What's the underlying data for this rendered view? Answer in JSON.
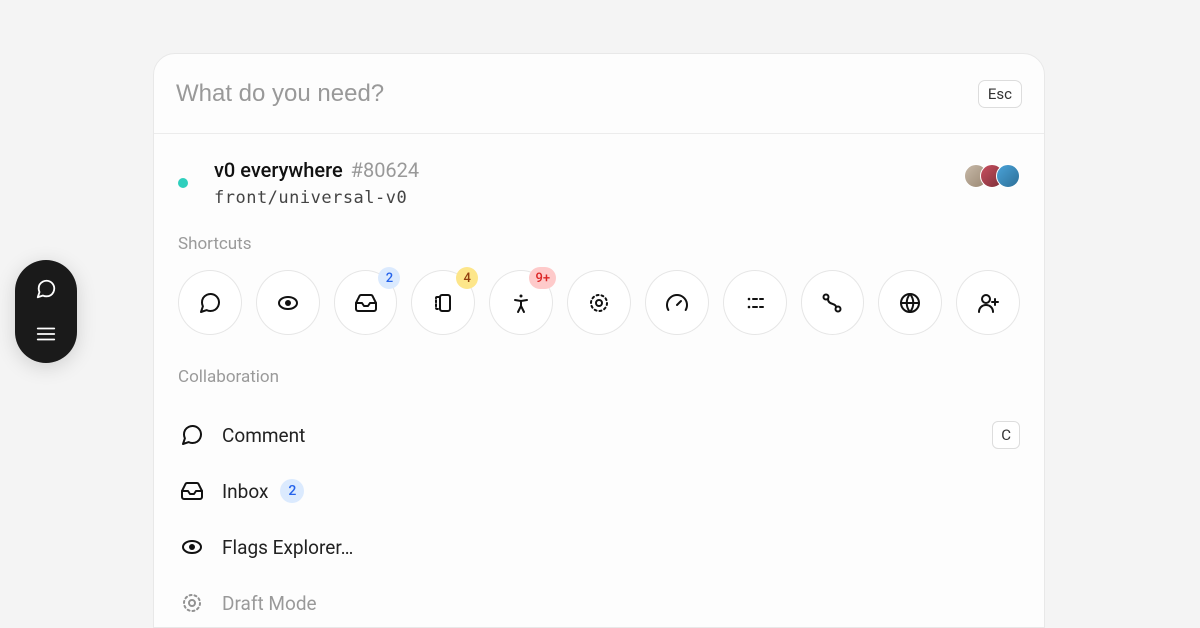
{
  "search": {
    "placeholder": "What do you need?",
    "esc_label": "Esc"
  },
  "top_result": {
    "title": "v0 everywhere",
    "id": "#80624",
    "branch": "front/universal-v0",
    "status": "open"
  },
  "sections": {
    "shortcuts_label": "Shortcuts",
    "collaboration_label": "Collaboration"
  },
  "shortcuts": [
    {
      "icon": "comment",
      "badge": null
    },
    {
      "icon": "eye",
      "badge": null
    },
    {
      "icon": "inbox",
      "badge": {
        "text": "2",
        "color": "blue"
      }
    },
    {
      "icon": "layout",
      "badge": {
        "text": "4",
        "color": "amber"
      }
    },
    {
      "icon": "accessibility",
      "badge": {
        "text": "9+",
        "color": "red"
      }
    },
    {
      "icon": "draft",
      "badge": null
    },
    {
      "icon": "gauge",
      "badge": null
    },
    {
      "icon": "grid",
      "badge": null
    },
    {
      "icon": "branch",
      "badge": null
    },
    {
      "icon": "globe",
      "badge": null
    },
    {
      "icon": "add-user",
      "badge": null
    }
  ],
  "collaboration": [
    {
      "icon": "comment",
      "label": "Comment",
      "count": null,
      "shortcut": "C",
      "faded": false
    },
    {
      "icon": "inbox",
      "label": "Inbox",
      "count": "2",
      "shortcut": null,
      "faded": false
    },
    {
      "icon": "eye",
      "label": "Flags Explorer…",
      "count": null,
      "shortcut": null,
      "faded": false
    },
    {
      "icon": "draft",
      "label": "Draft Mode",
      "count": null,
      "shortcut": null,
      "faded": true
    }
  ]
}
